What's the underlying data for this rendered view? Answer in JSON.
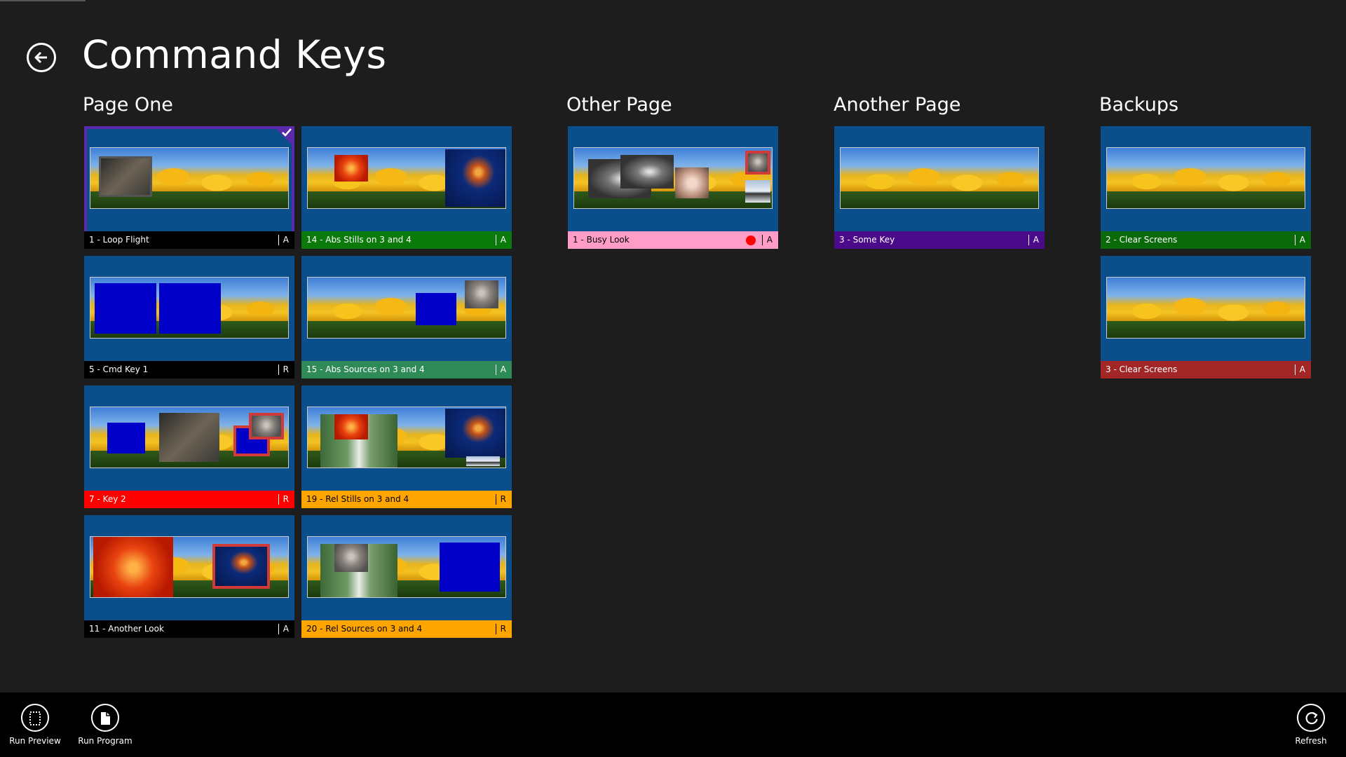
{
  "page": {
    "title": "Command Keys"
  },
  "groups": [
    {
      "title": "Page One"
    },
    {
      "title": "Other Page"
    },
    {
      "title": "Another Page"
    },
    {
      "title": "Backups"
    }
  ],
  "tiles": [
    {
      "label": "1 - Loop Flight",
      "mode": "A",
      "bar_color": "#000000",
      "selected": true
    },
    {
      "label": "14 - Abs Stills on 3 and 4",
      "mode": "A",
      "bar_color": "#0a7a0a"
    },
    {
      "label": "5 - Cmd Key 1",
      "mode": "R",
      "bar_color": "#000000"
    },
    {
      "label": "15 - Abs Sources on 3 and 4",
      "mode": "A",
      "bar_color": "#2e8b57"
    },
    {
      "label": "7 - Key 2",
      "mode": "R",
      "bar_color": "#ff0000"
    },
    {
      "label": "19 - Rel Stills on 3 and 4",
      "mode": "R",
      "bar_color": "#ffa500"
    },
    {
      "label": "11 - Another Look",
      "mode": "A",
      "bar_color": "#000000"
    },
    {
      "label": "20 - Rel Sources on 3 and 4",
      "mode": "R",
      "bar_color": "#ffa500"
    },
    {
      "label": "1 - Busy Look",
      "mode": "A",
      "bar_color": "#ff9cc8",
      "status_dot_color": "#ff0000"
    },
    {
      "label": "3 - Some Key",
      "mode": "A",
      "bar_color": "#4b0a8a"
    },
    {
      "label": "2 - Clear Screens",
      "mode": "A",
      "bar_color": "#0a6a0a"
    },
    {
      "label": "3 - Clear Screens",
      "mode": "A",
      "bar_color": "#a32626"
    }
  ],
  "app_bar": {
    "run_preview": "Run Preview",
    "run_program": "Run Program",
    "refresh": "Refresh"
  },
  "icons": {
    "back": "back-arrow-icon",
    "run_preview": "dashed-page-icon",
    "run_program": "page-icon",
    "refresh": "refresh-icon",
    "selected": "checkmark-icon"
  }
}
